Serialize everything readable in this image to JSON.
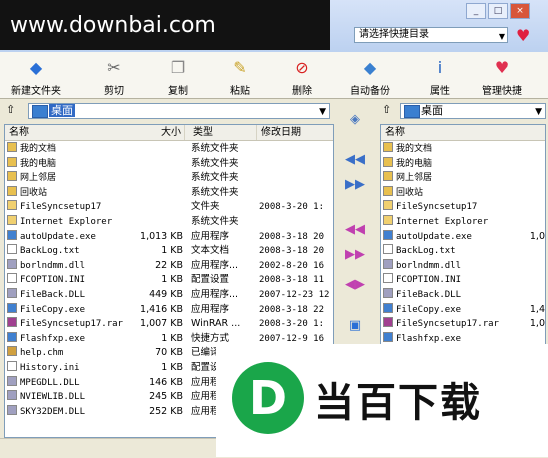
{
  "watermark": "www.downbai.com",
  "shortcut_select": "请选择快捷目录",
  "toolbar": [
    {
      "label": "新建文件夹",
      "icon": "new-folder-icon",
      "color": "#2a6fd6"
    },
    {
      "label": "剪切",
      "icon": "scissors-icon",
      "color": "#666666"
    },
    {
      "label": "复制",
      "icon": "copy-icon",
      "color": "#888888"
    },
    {
      "label": "粘贴",
      "icon": "paste-icon",
      "color": "#c9a227"
    },
    {
      "label": "删除",
      "icon": "delete-icon",
      "color": "#d82020"
    },
    {
      "label": "自动备份",
      "icon": "auto-backup-icon",
      "color": "#3a80d0"
    },
    {
      "label": "属性",
      "icon": "info-icon",
      "color": "#2060c0"
    },
    {
      "label": "管理快捷",
      "icon": "heart-icon",
      "color": "#e03050"
    }
  ],
  "left_pane": {
    "path": "桌面",
    "columns": {
      "name": "名称",
      "size": "大小",
      "type": "类型",
      "date": "修改日期"
    },
    "rows": [
      {
        "name": "我的文档",
        "size": "",
        "type": "系统文件夹",
        "date": ""
      },
      {
        "name": "我的电脑",
        "size": "",
        "type": "系统文件夹",
        "date": ""
      },
      {
        "name": "网上邻居",
        "size": "",
        "type": "系统文件夹",
        "date": ""
      },
      {
        "name": "回收站",
        "size": "",
        "type": "系统文件夹",
        "date": ""
      },
      {
        "name": "FileSyncsetup17",
        "size": "",
        "type": "文件夹",
        "date": "2008-3-20 1:"
      },
      {
        "name": "Internet Explorer",
        "size": "",
        "type": "系统文件夹",
        "date": ""
      },
      {
        "name": "autoUpdate.exe",
        "size": "1,013 KB",
        "type": "应用程序",
        "date": "2008-3-18 20"
      },
      {
        "name": "BackLog.txt",
        "size": "1 KB",
        "type": "文本文档",
        "date": "2008-3-18 20"
      },
      {
        "name": "borlndmm.dll",
        "size": "22 KB",
        "type": "应用程序...",
        "date": "2002-8-20 16"
      },
      {
        "name": "FCOPTION.INI",
        "size": "1 KB",
        "type": "配置设置",
        "date": "2008-3-18 11"
      },
      {
        "name": "FileBack.DLL",
        "size": "449 KB",
        "type": "应用程序...",
        "date": "2007-12-23 12"
      },
      {
        "name": "FileCopy.exe",
        "size": "1,416 KB",
        "type": "应用程序",
        "date": "2008-3-18 22"
      },
      {
        "name": "FileSyncsetup17.rar",
        "size": "1,007 KB",
        "type": "WinRAR ...",
        "date": "2008-3-20 1:"
      },
      {
        "name": "Flashfxp.exe",
        "size": "1 KB",
        "type": "快捷方式",
        "date": "2007-12-9 16"
      },
      {
        "name": "help.chm",
        "size": "70 KB",
        "type": "已编译",
        "date": ""
      },
      {
        "name": "History.ini",
        "size": "1 KB",
        "type": "配置设",
        "date": ""
      },
      {
        "name": "MPEGDLL.DLL",
        "size": "146 KB",
        "type": "应用程",
        "date": ""
      },
      {
        "name": "NVIEWLIB.DLL",
        "size": "245 KB",
        "type": "应用程",
        "date": ""
      },
      {
        "name": "SKY32DEM.DLL",
        "size": "252 KB",
        "type": "应用程",
        "date": ""
      }
    ]
  },
  "right_pane": {
    "path": "桌面",
    "columns": {
      "name": "名称"
    },
    "rows": [
      {
        "name": "我的文档",
        "size": ""
      },
      {
        "name": "我的电脑",
        "size": ""
      },
      {
        "name": "网上邻居",
        "size": ""
      },
      {
        "name": "回收站",
        "size": ""
      },
      {
        "name": "FileSyncsetup17",
        "size": ""
      },
      {
        "name": "Internet Explorer",
        "size": ""
      },
      {
        "name": "autoUpdate.exe",
        "size": "1,0"
      },
      {
        "name": "BackLog.txt",
        "size": ""
      },
      {
        "name": "borlndmm.dll",
        "size": ""
      },
      {
        "name": "FCOPTION.INI",
        "size": ""
      },
      {
        "name": "FileBack.DLL",
        "size": ""
      },
      {
        "name": "FileCopy.exe",
        "size": "1,4"
      },
      {
        "name": "FileSyncsetup17.rar",
        "size": "1,0"
      },
      {
        "name": "Flashfxp.exe",
        "size": ""
      }
    ]
  },
  "logo_text": "当百下载",
  "logo_letter": "D"
}
